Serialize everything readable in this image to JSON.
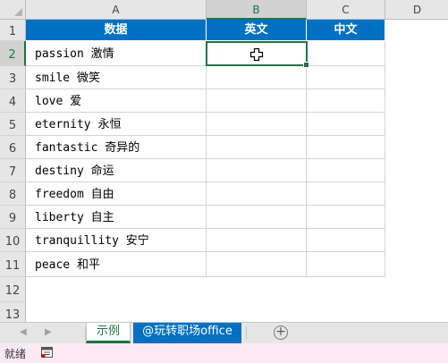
{
  "columns": [
    "A",
    "B",
    "C",
    "D"
  ],
  "rows": [
    "1",
    "2",
    "3",
    "4",
    "5",
    "6",
    "7",
    "8",
    "9",
    "10",
    "11",
    "12",
    "13"
  ],
  "table": {
    "headers": [
      "数据",
      "英文",
      "中文"
    ],
    "rows": [
      [
        "passion 激情",
        "",
        ""
      ],
      [
        "smile 微笑",
        "",
        ""
      ],
      [
        "love 爱",
        "",
        ""
      ],
      [
        "eternity 永恒",
        "",
        ""
      ],
      [
        "fantastic 奇异的",
        "",
        ""
      ],
      [
        "destiny 命运",
        "",
        ""
      ],
      [
        "freedom 自由",
        "",
        ""
      ],
      [
        "liberty 自主",
        "",
        ""
      ],
      [
        "tranquillity 安宁",
        "",
        ""
      ],
      [
        "peace 和平",
        "",
        ""
      ]
    ]
  },
  "active_cell": "B2",
  "sheet_tabs": {
    "nav_prev": "◀",
    "nav_next": "▶",
    "tabs": [
      "示例",
      "@玩转职场office"
    ],
    "add_symbol": "+"
  },
  "status_bar": {
    "ready": "就绪",
    "macro_icon": "macro-record-icon"
  },
  "colors": {
    "header_fill": "#0070c0",
    "accent_green": "#217346",
    "status_bg": "#fbeaf2"
  }
}
